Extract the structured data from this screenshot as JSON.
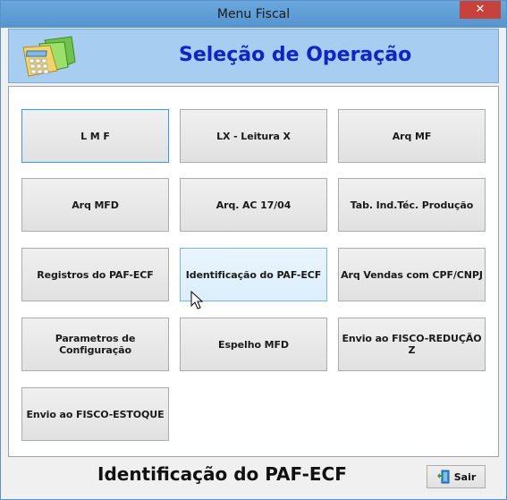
{
  "window": {
    "title": "Menu Fiscal",
    "close_label": "✕"
  },
  "header": {
    "title": "Seleção de Operação",
    "logo_icon": "calculator-folder-icon"
  },
  "buttons": [
    {
      "label": "L M F"
    },
    {
      "label": "LX - Leitura X"
    },
    {
      "label": "Arq MF"
    },
    {
      "label": "Arq MFD"
    },
    {
      "label": "Arq. AC 17/04"
    },
    {
      "label": "Tab. Ind.Téc. Produção"
    },
    {
      "label": "Registros do PAF-ECF"
    },
    {
      "label": "Identificação do PAF-ECF"
    },
    {
      "label": "Arq Vendas com CPF/CNPJ"
    },
    {
      "label": "Parametros de Configuração"
    },
    {
      "label": "Espelho MFD"
    },
    {
      "label": "Envio ao FISCO-REDUÇÃO Z"
    },
    {
      "label": "Envio ao FISCO-ESTOQUE"
    }
  ],
  "footer": {
    "status": "Identificação do PAF-ECF",
    "exit_label": "Sair",
    "exit_icon": "exit-door-icon"
  },
  "colors": {
    "titlebar": "#5b9bd5",
    "header_bg": "#a7cdf0",
    "header_title": "#1222c8",
    "close": "#c7423b"
  }
}
